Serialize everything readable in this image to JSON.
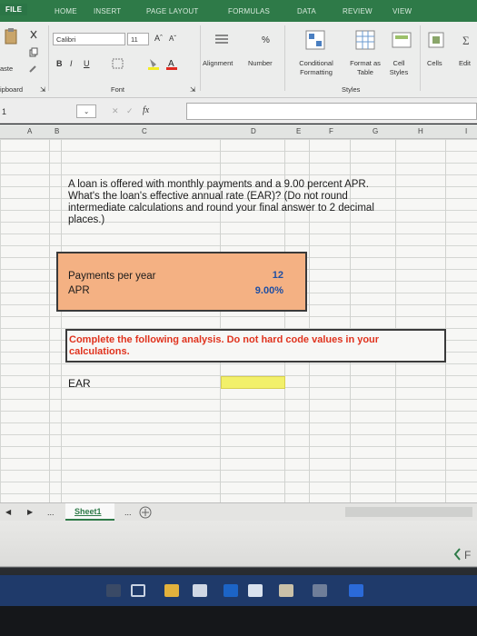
{
  "ribbon": {
    "tabs": [
      "FILE",
      "HOME",
      "INSERT",
      "PAGE LAYOUT",
      "FORMULAS",
      "DATA",
      "REVIEW",
      "VIEW"
    ],
    "font_name": "Calibri",
    "font_size": "11",
    "bold": "B",
    "italic": "I",
    "underline": "U",
    "paste_label": "aste",
    "clipboard_label": "ipboard",
    "font_group_label": "Font",
    "alignment_label": "Alignment",
    "number_label": "Number",
    "percent_label": "%",
    "conditional_formatting_label": "Conditional Formatting",
    "format_as_table_label": "Format as Table",
    "cell_styles_label": "Cell Styles",
    "styles_group_label": "Styles",
    "cells_label": "Cells",
    "editing_label": "Edit"
  },
  "formula_bar": {
    "name_box": "1",
    "fx_label": "fx"
  },
  "columns": [
    "A",
    "B",
    "C",
    "D",
    "E",
    "F",
    "G",
    "H",
    "I"
  ],
  "sheet": {
    "problem_text": "A loan is offered with monthly payments and a 9.00 percent APR. What's the loan's effective annual rate (EAR)? (Do not round intermediate calculations and round your final answer to 2 decimal places.)",
    "inputs": [
      {
        "label": "Payments per year",
        "value": "12"
      },
      {
        "label": "APR",
        "value": "9.00%"
      }
    ],
    "instruction": "Complete the following analysis. Do not hard code values in your calculations.",
    "ear_label": "EAR",
    "ear_value": ""
  },
  "sheet_tabs": {
    "active": "Sheet1",
    "ellipsis_left": "...",
    "ellipsis_right": "..."
  },
  "colors": {
    "ribbon_green": "#2e7a48",
    "input_box": "#f4b183",
    "value_blue": "#1f4fa3",
    "instruction_red": "#e0331e",
    "ear_highlight": "#f2f06a"
  }
}
